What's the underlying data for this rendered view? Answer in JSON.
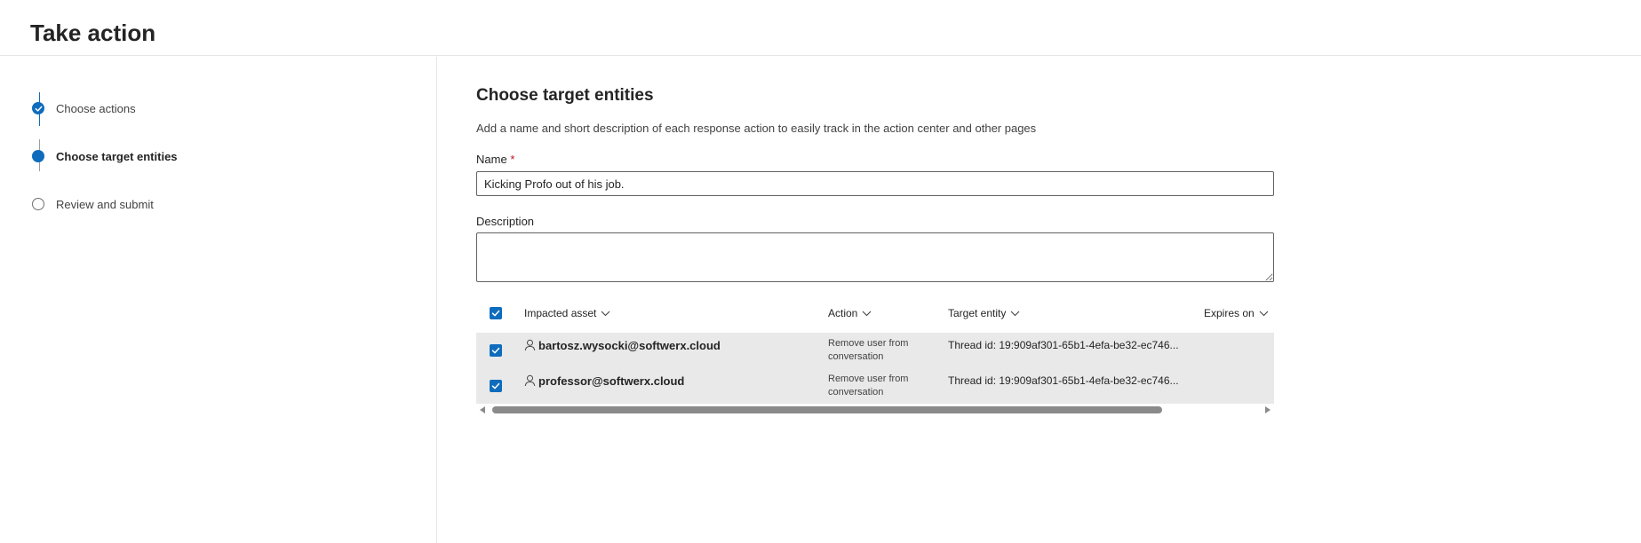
{
  "header": {
    "title": "Take action"
  },
  "steps": [
    {
      "label": "Choose actions",
      "state": "done"
    },
    {
      "label": "Choose target entities",
      "state": "current"
    },
    {
      "label": "Review and submit",
      "state": "pending"
    }
  ],
  "main": {
    "title": "Choose target entities",
    "description": "Add a name and short description of each response action to easily track in the action center and other pages",
    "name_label": "Name",
    "required_mark": "*",
    "name_value": "Kicking Profo out of his job.",
    "description_label": "Description",
    "description_value": ""
  },
  "table": {
    "columns": {
      "impacted_asset": "Impacted asset",
      "action": "Action",
      "target_entity": "Target entity",
      "expires_on": "Expires on"
    },
    "rows": [
      {
        "asset": "bartosz.wysocki@softwerx.cloud",
        "action": "Remove user from conversation",
        "target": "Thread id: 19:909af301-65b1-4efa-be32-ec746...",
        "expires": ""
      },
      {
        "asset": "professor@softwerx.cloud",
        "action": "Remove user from conversation",
        "target": "Thread id: 19:909af301-65b1-4efa-be32-ec746...",
        "expires": ""
      }
    ]
  },
  "colors": {
    "accent": "#0f6cbd",
    "row_bg": "#e9e9e9",
    "required": "#c50f1f"
  },
  "icons": [
    "check-icon",
    "chevron-down-icon",
    "person-icon",
    "scroll-left-icon",
    "scroll-right-icon"
  ]
}
